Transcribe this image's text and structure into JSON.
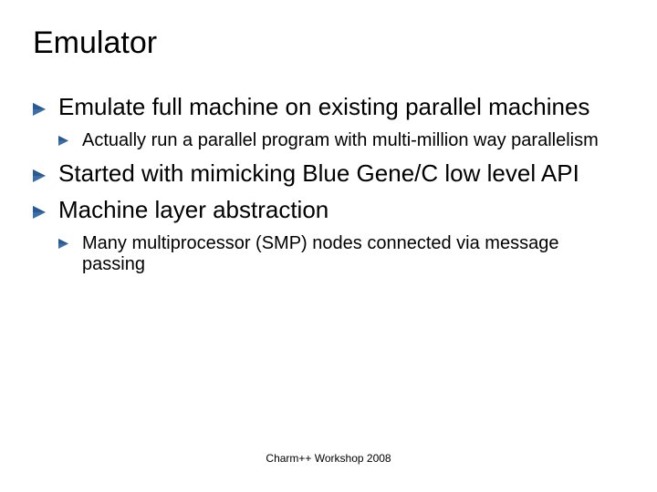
{
  "title": "Emulator",
  "items": [
    {
      "text": "Emulate full machine on existing parallel machines",
      "sub": [
        {
          "text": "Actually run a parallel program with multi-million way parallelism"
        }
      ]
    },
    {
      "text": "Started with mimicking Blue Gene/C low level API",
      "sub": []
    },
    {
      "text": "Machine layer abstraction",
      "sub": [
        {
          "text": "Many multiprocessor (SMP) nodes connected via message passing"
        }
      ]
    }
  ],
  "footer": "Charm++ Workshop 2008"
}
